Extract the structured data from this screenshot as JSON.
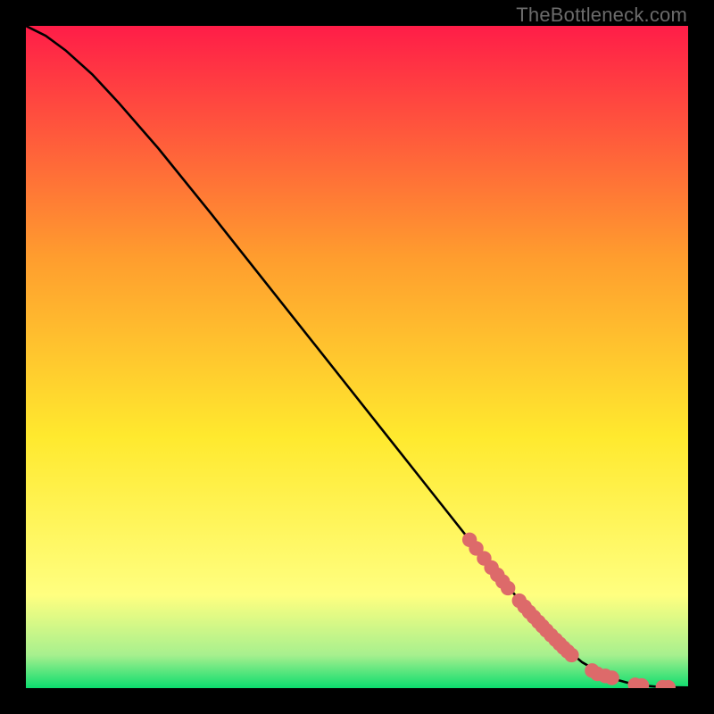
{
  "attribution": "TheBottleneck.com",
  "chart_data": {
    "type": "line",
    "title": "",
    "xlabel": "",
    "ylabel": "",
    "xlim": [
      0,
      100
    ],
    "ylim": [
      0,
      100
    ],
    "gradient_colors": {
      "top": "#ff1d48",
      "upper_mid": "#ff9d2e",
      "mid": "#ffe92e",
      "lower_mid": "#ffff80",
      "near_bottom": "#a7f08e",
      "bottom": "#0cdc6e"
    },
    "series": [
      {
        "name": "curve",
        "type": "line",
        "color": "#000000",
        "x": [
          0,
          3,
          6,
          10,
          14,
          20,
          28,
          36,
          44,
          52,
          60,
          68,
          74,
          80,
          84,
          88,
          92,
          96,
          100
        ],
        "y": [
          100,
          98.5,
          96.3,
          92.7,
          88.4,
          81.5,
          71.6,
          61.5,
          51.4,
          41.3,
          31.2,
          21.1,
          13.9,
          7.3,
          3.9,
          1.6,
          0.5,
          0.15,
          0.1
        ]
      },
      {
        "name": "markers",
        "type": "scatter",
        "color": "#dd6a6a",
        "x": [
          67.0,
          68.0,
          69.2,
          70.3,
          71.2,
          72.0,
          72.8,
          74.5,
          75.3,
          76.0,
          76.7,
          77.4,
          78.0,
          78.6,
          79.3,
          80.0,
          80.6,
          81.2,
          81.8,
          82.4,
          85.5,
          86.3,
          87.5,
          88.5,
          92.0,
          93.0,
          96.2,
          97.0
        ],
        "y": [
          22.4,
          21.1,
          19.6,
          18.2,
          17.1,
          16.1,
          15.1,
          13.2,
          12.3,
          11.5,
          10.75,
          10.0,
          9.35,
          8.72,
          8.0,
          7.3,
          6.7,
          6.1,
          5.55,
          5.0,
          2.65,
          2.15,
          1.85,
          1.55,
          0.5,
          0.4,
          0.15,
          0.12
        ]
      }
    ]
  }
}
